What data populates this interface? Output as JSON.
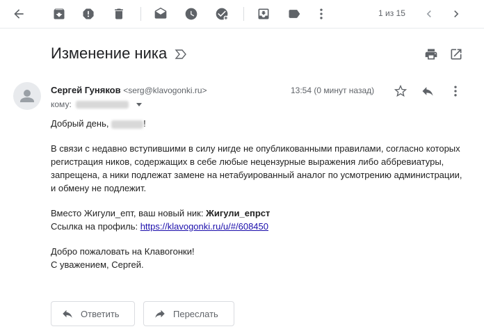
{
  "toolbar": {
    "pager": "1 из 15"
  },
  "email": {
    "subject": "Изменение ника",
    "sender_name": "Сергей Гуняков",
    "sender_email": "<serg@klavogonki.ru>",
    "time": "13:54 (0 минут назад)",
    "to_label": "кому:",
    "greeting_prefix": "Добрый день, ",
    "greeting_suffix": "!",
    "paragraph1": "В связи с недавно вступившими в силу нигде не опубликованными правилами, согласно которых регистрация ников, содержащих в себе любые нецензурные выражения либо аббревиатуры, запрещена, а ники подлежат замене на нетабуированный аналог по усмотрению администрации, и обмену не подлежит.",
    "nick_prefix": "Вместо Жигули_епт, ваш новый ник: ",
    "nick_new": "Жигули_епрст",
    "profile_prefix": "Ссылка на профиль: ",
    "profile_link": "https://klavogonki.ru/u/#/608450",
    "welcome": "Добро пожаловать на Клавогонки!",
    "signoff": "С уважением, Сергей."
  },
  "actions": {
    "reply": "Ответить",
    "forward": "Переслать"
  }
}
